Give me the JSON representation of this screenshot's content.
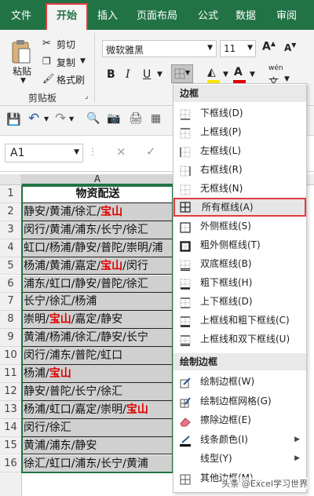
{
  "ribbon": {
    "tabs": [
      "文件",
      "开始",
      "插入",
      "页面布局",
      "公式",
      "数据",
      "审阅"
    ],
    "active_tab": "开始",
    "clipboard": {
      "paste_label": "粘贴",
      "cut_label": "剪切",
      "copy_label": "复制",
      "format_painter_label": "格式刷",
      "group_label": "剪贴板"
    },
    "font": {
      "font_name": "微软雅黑",
      "font_size": "11",
      "bold_label": "B",
      "italic_label": "I",
      "underline_label": "U",
      "phonetic_label": "wén"
    }
  },
  "formula_bar": {
    "name_box": "A1",
    "cancel_symbol": "×",
    "enter_symbol": "✓"
  },
  "sheet": {
    "column_header": "A",
    "rows": [
      {
        "num": "1",
        "text": "物资配送",
        "red": "",
        "after": ""
      },
      {
        "num": "2",
        "text": "静安/黄浦/徐汇/",
        "red": "宝山",
        "after": ""
      },
      {
        "num": "3",
        "text": "闵行/黄浦/浦东/长宁/徐汇",
        "red": "",
        "after": ""
      },
      {
        "num": "4",
        "text": "虹口/杨浦/静安/普陀/崇明/浦",
        "red": "",
        "after": ""
      },
      {
        "num": "5",
        "text": "杨浦/黄浦/嘉定/",
        "red": "宝山",
        "after": "/闵行"
      },
      {
        "num": "6",
        "text": "浦东/虹口/静安/普陀/徐汇",
        "red": "",
        "after": ""
      },
      {
        "num": "7",
        "text": "长宁/徐汇/杨浦",
        "red": "",
        "after": ""
      },
      {
        "num": "8",
        "text": "崇明/",
        "red": "宝山",
        "after": "/嘉定/静安"
      },
      {
        "num": "9",
        "text": "黄浦/杨浦/徐汇/静安/长宁",
        "red": "",
        "after": ""
      },
      {
        "num": "10",
        "text": "闵行/浦东/普陀/虹口",
        "red": "",
        "after": ""
      },
      {
        "num": "11",
        "text": "杨浦/",
        "red": "宝山",
        "after": ""
      },
      {
        "num": "12",
        "text": "静安/普陀/长宁/徐汇",
        "red": "",
        "after": ""
      },
      {
        "num": "13",
        "text": "杨浦/虹口/嘉定/崇明/",
        "red": "宝山",
        "after": ""
      },
      {
        "num": "14",
        "text": "闵行/徐汇",
        "red": "",
        "after": ""
      },
      {
        "num": "15",
        "text": "黄浦/浦东/静安",
        "red": "",
        "after": ""
      },
      {
        "num": "16",
        "text": "徐汇/虹口/浦东/长宁/黄浦",
        "red": "",
        "after": ""
      }
    ]
  },
  "border_menu": {
    "section1": "边框",
    "items1": [
      "下框线(D)",
      "上框线(P)",
      "左框线(L)",
      "右框线(R)",
      "无框线(N)",
      "所有框线(A)",
      "外侧框线(S)",
      "粗外侧框线(T)",
      "双底框线(B)",
      "粗下框线(H)",
      "上下框线(D)",
      "上框线和粗下框线(C)",
      "上框线和双下框线(U)"
    ],
    "highlighted": "所有框线(A)",
    "section2": "绘制边框",
    "items2": [
      "绘制边框(W)",
      "绘制边框网格(G)",
      "擦除边框(E)",
      "线条颜色(I)",
      "线型(Y)",
      "其他边框(M)..."
    ]
  },
  "watermark": "头条 @Excel学习世界"
}
